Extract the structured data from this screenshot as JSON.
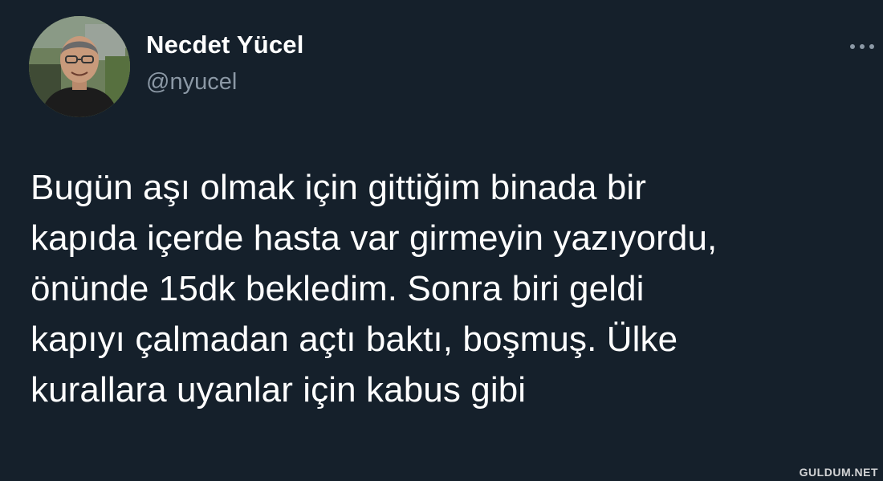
{
  "tweet": {
    "author": {
      "display_name": "Necdet Yücel",
      "handle": "@nyucel"
    },
    "more_icon": "more-horizontal-icon",
    "text": "Bugün aşı olmak için gittiğim binada bir\nkapıda içerde hasta var girmeyin yazıyordu,\nönünde 15dk bekledim. Sonra biri geldi\nkapıyı çalmadan açtı baktı, boşmuş. Ülke\nkurallara uyanlar için kabus gibi"
  },
  "watermark": {
    "text": "GULDUM.NET"
  },
  "colors": {
    "background": "#15202b",
    "text_primary": "#ffffff",
    "text_secondary": "#8b98a5"
  }
}
